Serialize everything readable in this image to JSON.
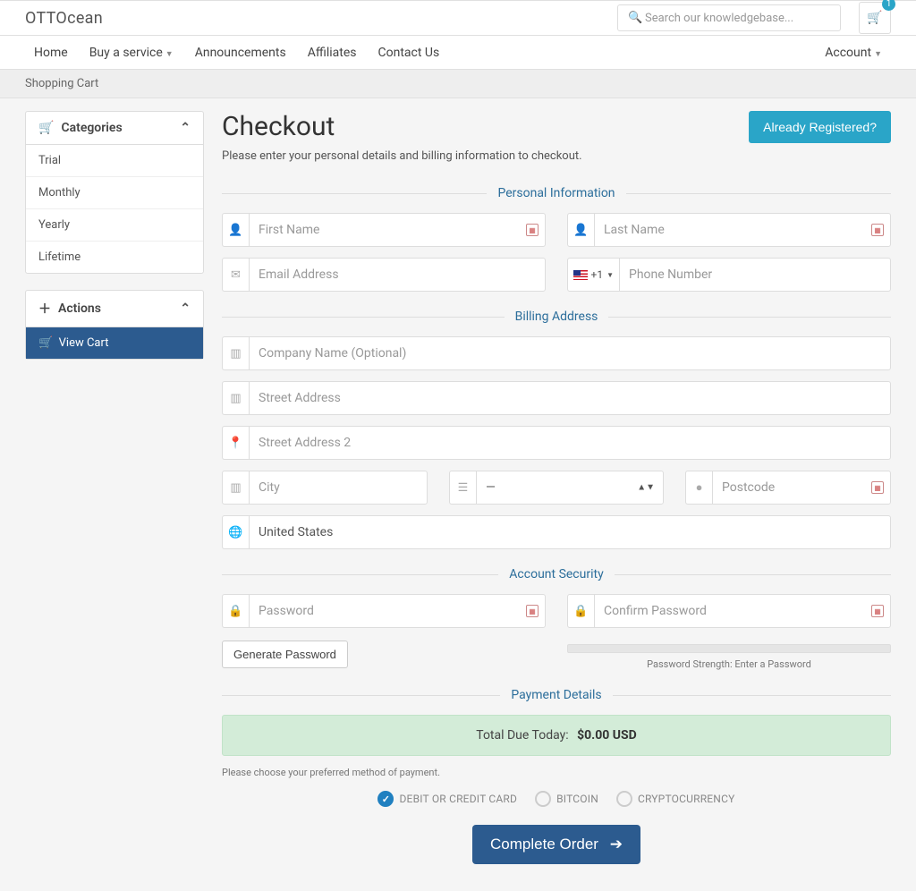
{
  "brand": "OTTOcean",
  "search": {
    "placeholder": "Search our knowledgebase..."
  },
  "cart_count": "1",
  "nav": {
    "home": "Home",
    "buy": "Buy a service",
    "announcements": "Announcements",
    "affiliates": "Affiliates",
    "contact": "Contact Us",
    "account": "Account"
  },
  "breadcrumb": "Shopping Cart",
  "sidebar": {
    "categories_title": "Categories",
    "categories": {
      "trial": "Trial",
      "monthly": "Monthly",
      "yearly": "Yearly",
      "lifetime": "Lifetime"
    },
    "actions_title": "Actions",
    "view_cart": "View Cart"
  },
  "checkout": {
    "title": "Checkout",
    "subtitle": "Please enter your personal details and billing information to checkout.",
    "already": "Already Registered?"
  },
  "sections": {
    "personal": "Personal Information",
    "billing": "Billing Address",
    "security": "Account Security",
    "payment": "Payment Details"
  },
  "fields": {
    "first_name": "First Name",
    "last_name": "Last Name",
    "email": "Email Address",
    "phone_code": "+1",
    "phone": "Phone Number",
    "company": "Company Name (Optional)",
    "street1": "Street Address",
    "street2": "Street Address 2",
    "city": "City",
    "state": "—",
    "postcode": "Postcode",
    "country": "United States",
    "password": "Password",
    "confirm": "Confirm Password"
  },
  "generate": "Generate Password",
  "strength": "Password Strength: Enter a Password",
  "total": {
    "label": "Total Due Today:",
    "amount": "$0.00 USD"
  },
  "pay_note": "Please choose your preferred method of payment.",
  "pay_opts": {
    "card": "DEBIT OR CREDIT CARD",
    "bitcoin": "BITCOIN",
    "crypto": "CRYPTOCURRENCY"
  },
  "complete": "Complete Order"
}
